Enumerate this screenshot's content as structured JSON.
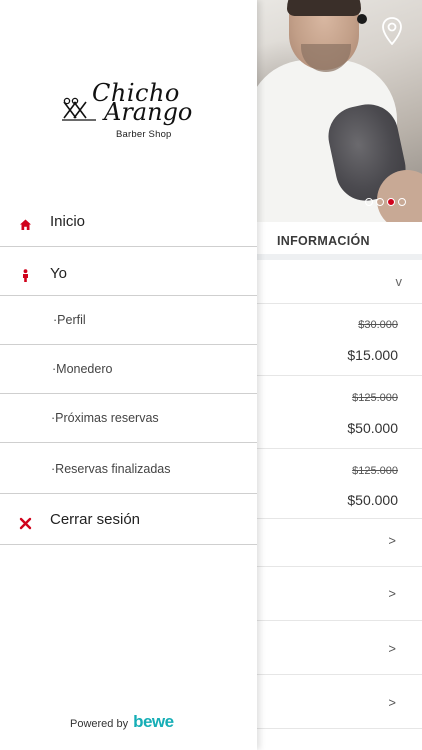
{
  "brand": {
    "logo_line1": "Chicho",
    "logo_line2": "Arango",
    "logo_sub": "Barber Shop"
  },
  "menu": {
    "items": [
      {
        "label": "Inicio",
        "icon": "home-icon"
      },
      {
        "label": "Yo",
        "icon": "person-icon"
      },
      {
        "label": "·Perfil"
      },
      {
        "label": "·Monedero"
      },
      {
        "label": "·Próximas reservas"
      },
      {
        "label": "·Reservas finalizadas"
      },
      {
        "label": "Cerrar sesión",
        "icon": "close-icon"
      }
    ]
  },
  "footer": {
    "powered_by": "Powered by",
    "brand": "bewe"
  },
  "main": {
    "section_label": "INFORMACIÓN",
    "toggle_chevron": "v",
    "carousel": {
      "count": 3,
      "active": 2
    },
    "prices": [
      {
        "old": "$30.000",
        "new": "$15.000"
      },
      {
        "old": "$125.000",
        "new": "$50.000"
      },
      {
        "old": "$125.000",
        "new": "$50.000"
      }
    ],
    "arrow_glyph": ">"
  },
  "colors": {
    "accent": "#d0021b",
    "brand_teal": "#16aeb6"
  }
}
